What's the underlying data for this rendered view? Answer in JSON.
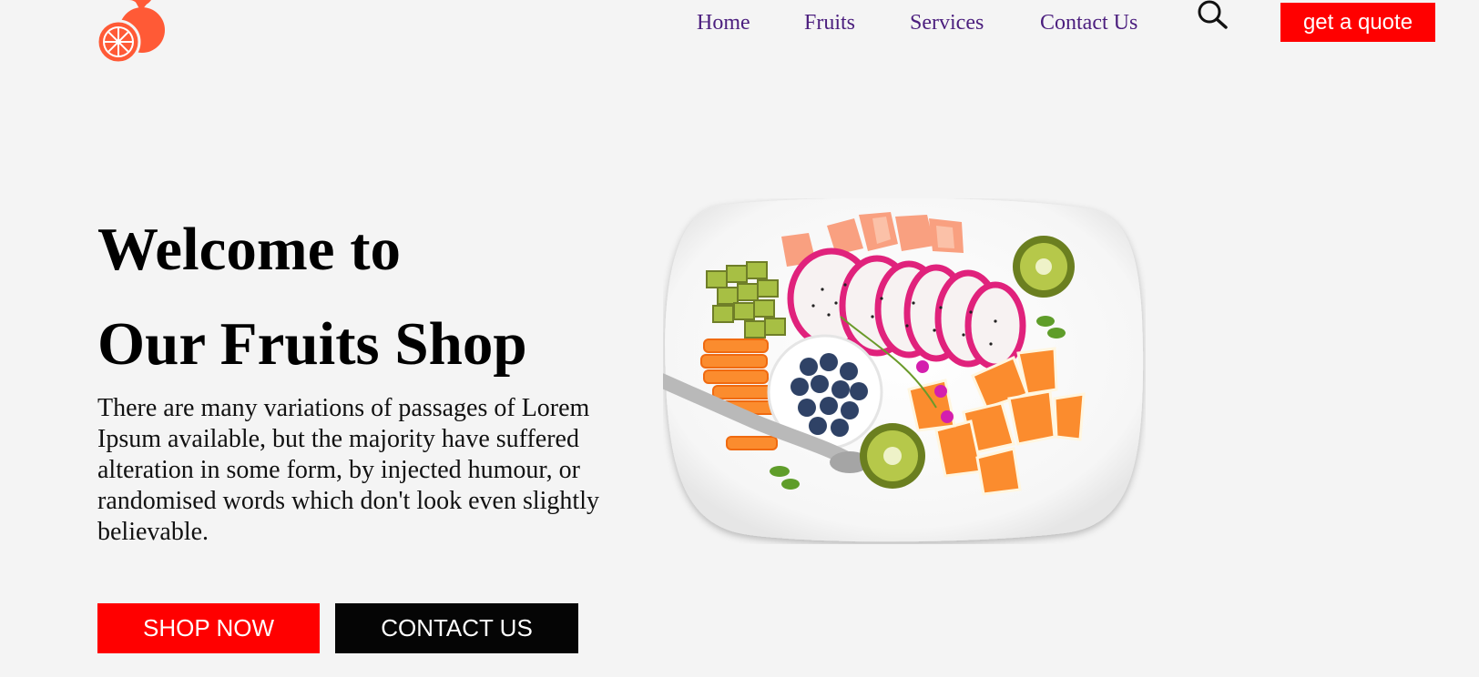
{
  "header": {
    "logo_icon": "orange-fruit-icon",
    "nav": [
      {
        "label": "Home"
      },
      {
        "label": "Fruits"
      },
      {
        "label": "Services"
      },
      {
        "label": "Contact Us"
      }
    ],
    "search_icon": "search-icon",
    "quote_button": "get a quote"
  },
  "hero": {
    "title_line1": "Welcome to",
    "title_line2": "Our Fruits Shop",
    "description": "There are many variations of passages of Lorem Ipsum available, but the majority have suffered alteration in some form, by injected humour, or randomised words which don't look even slightly believable.",
    "shop_button": "SHOP NOW",
    "contact_button": "CONTACT US",
    "image_icon": "fruit-plate-image"
  },
  "colors": {
    "accent": "#ff0000",
    "nav_text": "#4b1e7e",
    "dark_button": "#050505",
    "logo": "#ff5a36",
    "background": "#f4f4f4"
  }
}
